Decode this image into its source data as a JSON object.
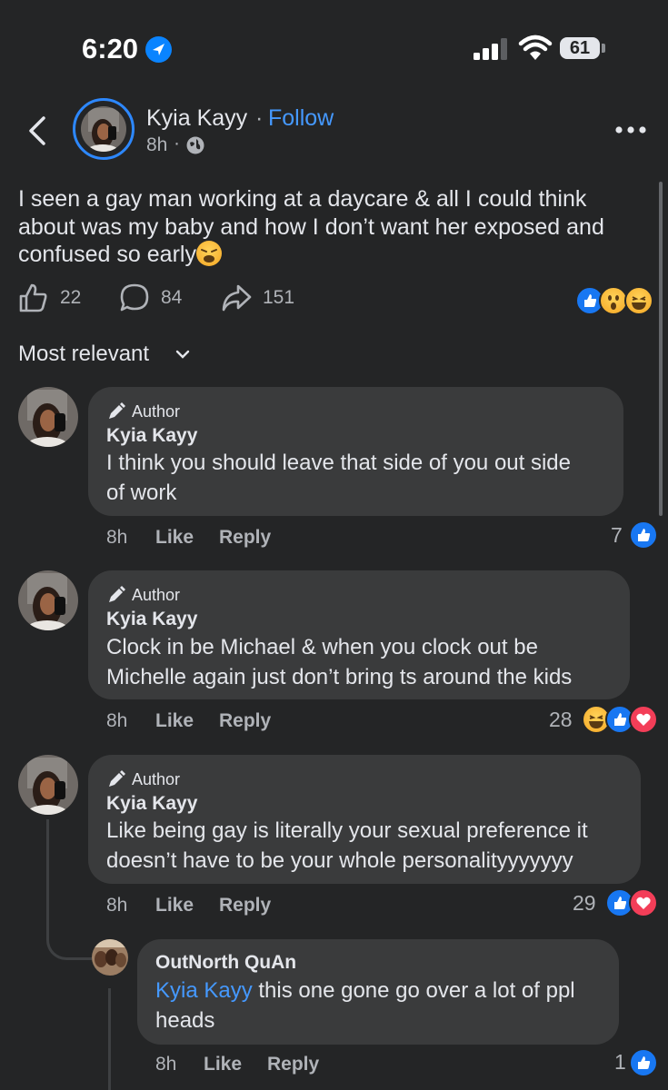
{
  "status_bar": {
    "time": "6:20",
    "battery": "61"
  },
  "post": {
    "author": "Kyia Kayy",
    "separator": "·",
    "follow_label": "Follow",
    "time": "8h",
    "time_sep": "·",
    "text": "I seen a gay man working at a daycare & all I could think about was my baby and how I don’t want her exposed and confused so early",
    "reaction_emoji": "weary-face-emoji",
    "likes": "22",
    "comments": "84",
    "shares": "151",
    "reactions": [
      "like",
      "wow",
      "haha"
    ]
  },
  "sort": {
    "label": "Most relevant"
  },
  "comments": [
    {
      "badge": "Author",
      "name": "Kyia Kayy",
      "lines": [
        "I think you should leave that side of you out side",
        "of work"
      ],
      "time": "8h",
      "like": "Like",
      "reply": "Reply",
      "count": "7",
      "reactions": [
        "like"
      ]
    },
    {
      "badge": "Author",
      "name": "Kyia Kayy",
      "lines": [
        "Clock in be Michael & when you clock out be",
        "Michelle again just don’t bring ts around the kids"
      ],
      "time": "8h",
      "like": "Like",
      "reply": "Reply",
      "count": "28",
      "reactions": [
        "haha",
        "like",
        "love"
      ]
    },
    {
      "badge": "Author",
      "name": "Kyia Kayy",
      "lines": [
        "Like being gay is literally your sexual preference it",
        "doesn’t have to be your whole personalityyyyyyy"
      ],
      "time": "8h",
      "like": "Like",
      "reply": "Reply",
      "count": "29",
      "reactions": [
        "like",
        "love"
      ]
    }
  ],
  "reply": {
    "name": "OutNorth QuAn",
    "mention": "Kyia Kayy",
    "line1": " this one gone go over a lot of ppl",
    "line2": "heads",
    "time": "8h",
    "like": "Like",
    "reply": "Reply",
    "count": "1",
    "reactions": [
      "like"
    ]
  },
  "colors": {
    "background": "#242526",
    "bubble": "#3a3b3c",
    "accent": "#4599ff",
    "like": "#1877f2",
    "love": "#f33e58"
  }
}
